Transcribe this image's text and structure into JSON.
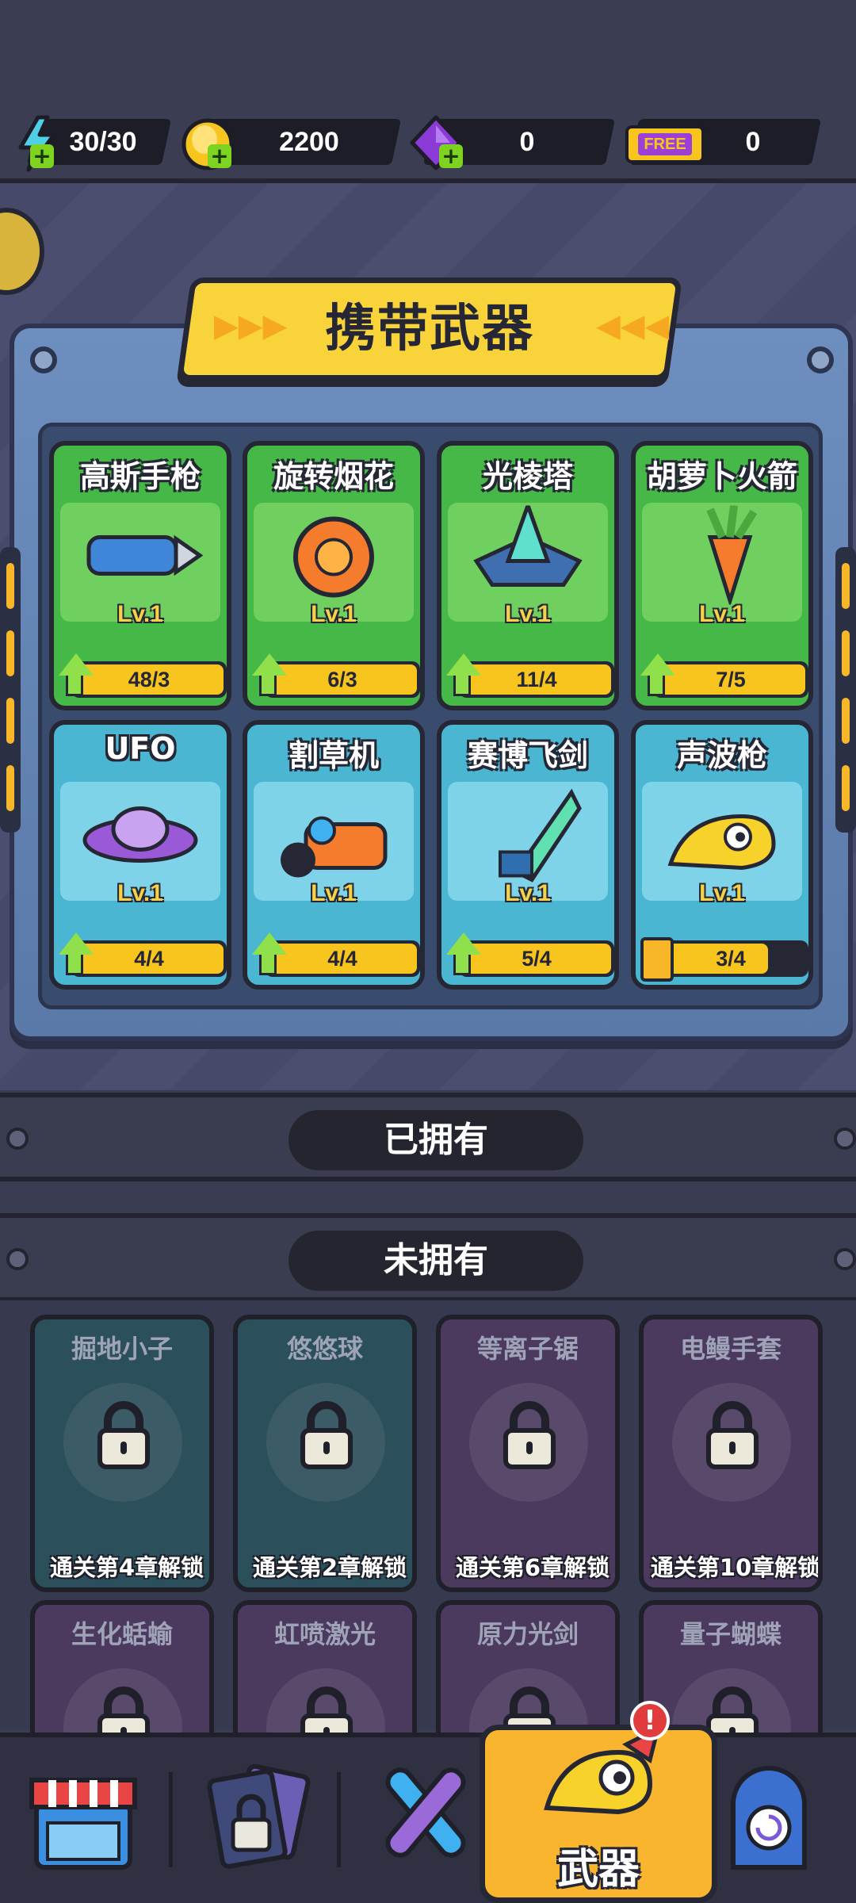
{
  "resources": [
    {
      "name": "energy",
      "value": "30/30",
      "icon": "lightning-icon",
      "color": "#4fd0e6"
    },
    {
      "name": "coins",
      "value": "2200",
      "icon": "coin-icon",
      "color": "#f7c51e"
    },
    {
      "name": "gems",
      "value": "0",
      "icon": "gem-icon",
      "color": "#8b3ad6"
    },
    {
      "name": "tickets",
      "value": "0",
      "icon": "free-ticket-icon",
      "icon_text": "FREE",
      "color": "#f7c51e"
    }
  ],
  "carry_title": "携带武器",
  "equipped": [
    {
      "name": "高斯手枪",
      "level": "Lv.1",
      "progress": "48/3",
      "fill": 1.0,
      "rarity": "green",
      "icon": "gauss-pistol-icon",
      "upgradable": true
    },
    {
      "name": "旋转烟花",
      "level": "Lv.1",
      "progress": "6/3",
      "fill": 1.0,
      "rarity": "green",
      "icon": "spinning-firework-icon",
      "upgradable": true
    },
    {
      "name": "光棱塔",
      "level": "Lv.1",
      "progress": "11/4",
      "fill": 1.0,
      "rarity": "green",
      "icon": "prism-tower-icon",
      "upgradable": true
    },
    {
      "name": "胡萝卜火箭",
      "level": "Lv.1",
      "progress": "7/5",
      "fill": 1.0,
      "rarity": "green",
      "icon": "carrot-rocket-icon",
      "upgradable": true
    },
    {
      "name": "UFO",
      "level": "Lv.1",
      "progress": "4/4",
      "fill": 1.0,
      "rarity": "blue",
      "icon": "ufo-icon",
      "upgradable": true
    },
    {
      "name": "割草机",
      "level": "Lv.1",
      "progress": "4/4",
      "fill": 1.0,
      "rarity": "blue",
      "icon": "lawn-mower-icon",
      "upgradable": true
    },
    {
      "name": "赛博飞剑",
      "level": "Lv.1",
      "progress": "5/4",
      "fill": 1.0,
      "rarity": "blue",
      "icon": "cyber-sword-icon",
      "upgradable": true
    },
    {
      "name": "声波枪",
      "level": "Lv.1",
      "progress": "3/4",
      "fill": 0.75,
      "rarity": "blue",
      "icon": "sonic-gun-icon",
      "upgradable": false
    }
  ],
  "owned_label": "已拥有",
  "not_owned_label": "未拥有",
  "locked": [
    {
      "name": "掘地小子",
      "condition": "通关第4章解锁",
      "tone": "teal",
      "icon": "digger-kid-icon"
    },
    {
      "name": "悠悠球",
      "condition": "通关第2章解锁",
      "tone": "teal",
      "icon": "yoyo-icon"
    },
    {
      "name": "等离子锯",
      "condition": "通关第6章解锁",
      "tone": "purple",
      "icon": "plasma-saw-icon"
    },
    {
      "name": "电鳗手套",
      "condition": "通关第10章解锁",
      "tone": "purple",
      "icon": "eel-glove-icon"
    },
    {
      "name": "生化蛞蝓",
      "condition": "",
      "tone": "purple",
      "icon": "bio-slug-icon"
    },
    {
      "name": "虹喷激光",
      "condition": "",
      "tone": "purple",
      "icon": "rainbow-laser-icon"
    },
    {
      "name": "原力光剑",
      "condition": "",
      "tone": "purple",
      "icon": "force-saber-icon"
    },
    {
      "name": "量子蝴蝶",
      "condition": "",
      "tone": "purple",
      "icon": "quantum-butterfly-icon"
    }
  ],
  "nav": {
    "items": [
      {
        "icon": "shop-icon"
      },
      {
        "icon": "locked-cards-icon"
      },
      {
        "icon": "battle-bats-icon"
      },
      {
        "icon": "weapon-icon",
        "label": "武器",
        "active": true,
        "badge": "!"
      },
      {
        "icon": "portal-icon"
      }
    ],
    "active_label": "武器",
    "badge": "!"
  }
}
